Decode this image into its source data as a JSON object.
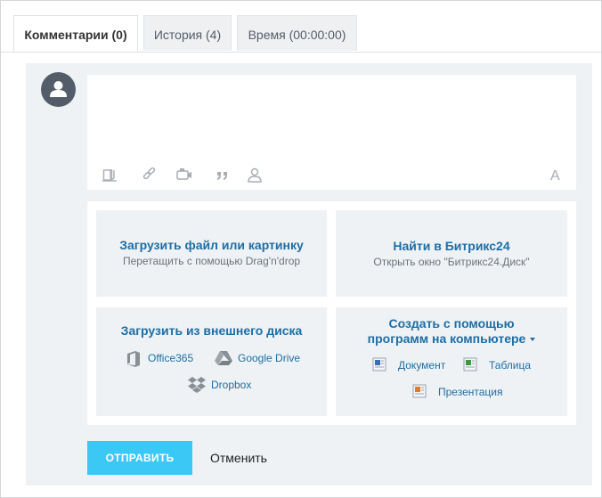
{
  "tabs": [
    {
      "label": "Комментарии (0)",
      "active": true
    },
    {
      "label": "История (4)",
      "active": false
    },
    {
      "label": "Время (00:00:00)",
      "active": false
    }
  ],
  "toolbar": {
    "icons": [
      "paperclip-icon",
      "link-icon",
      "video-icon",
      "quote-icon",
      "mention-icon"
    ],
    "format_glyph": "A"
  },
  "upload": {
    "file_title": "Загрузить файл или картинку",
    "file_sub": "Перетащить с помощью Drag'n'drop",
    "b24_title": "Найти в Битрикс24",
    "b24_sub": "Открыть окно \"Битрикс24.Диск\"",
    "ext_title": "Загрузить из внешнего диска",
    "office365": "Office365",
    "gdrive": "Google Drive",
    "dropbox": "Dropbox",
    "create_title_line1": "Создать с помощью",
    "create_title_line2": "программ на компьютере",
    "doc": "Документ",
    "table": "Таблица",
    "pres": "Презентация"
  },
  "buttons": {
    "send": "ОТПРАВИТЬ",
    "cancel": "Отменить"
  },
  "colors": {
    "accent": "#3bc8f5",
    "link": "#1d6ea6",
    "avatar": "#535c69"
  }
}
